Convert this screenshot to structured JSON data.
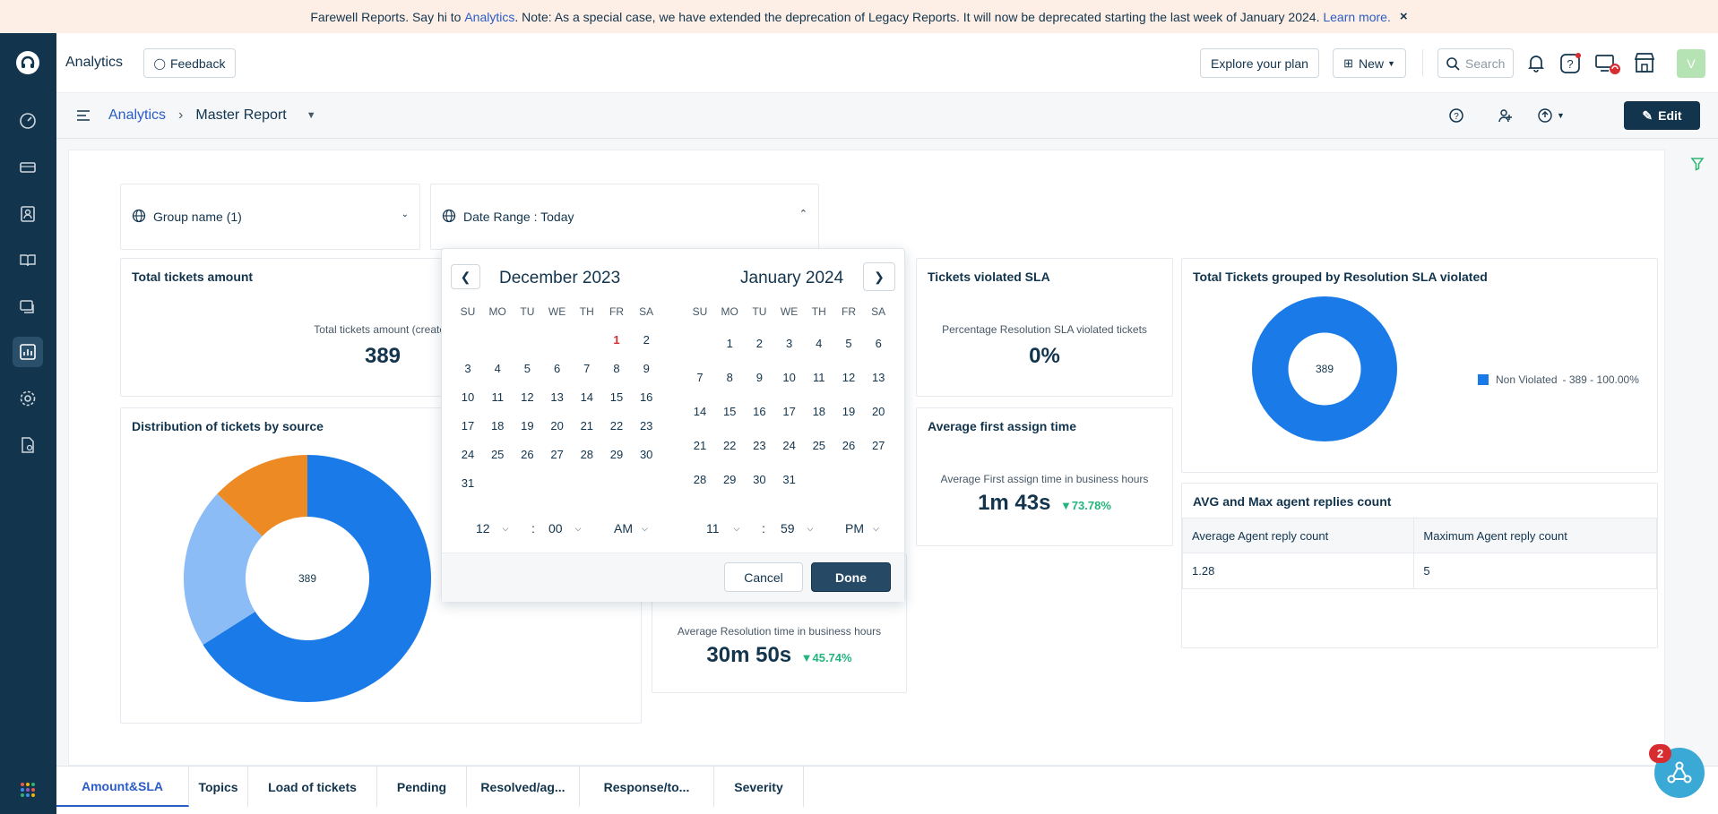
{
  "banner": {
    "text1": "Farewell Reports. Say hi to",
    "link1": "Analytics",
    "text2": ". Note: As a special case, we have extended the deprecation of Legacy Reports. It will now be deprecated starting the last week of January 2024.",
    "link2": "Learn more.",
    "close": "×"
  },
  "topbar": {
    "app_name": "Analytics",
    "feedback": "Feedback",
    "explore": "Explore your plan",
    "new": "New",
    "search_placeholder": "Search",
    "avatar": "V"
  },
  "breadcrumb": {
    "root": "Analytics",
    "sep": "›",
    "current": "Master Report"
  },
  "edit_label": "Edit",
  "filters": {
    "group": "Group name (1)",
    "date": "Date Range :  Today"
  },
  "cards": {
    "total_tickets": {
      "title": "Total tickets amount",
      "sub": "Total tickets amount (created",
      "value": "389"
    },
    "distribution": {
      "title": "Distribution of tickets by source",
      "center": "389"
    },
    "sla_violated": {
      "title": "Tickets violated SLA",
      "sub": "Percentage Resolution SLA violated tickets",
      "value": "0%"
    },
    "first_assign": {
      "title": "Average first assign time",
      "sub": "Average First assign time in business hours",
      "value": "1m 43s",
      "delta": "73.78%"
    },
    "resolution": {
      "sub": "Average Resolution time in business hours",
      "value": "30m 50s",
      "delta": "45.74%"
    },
    "grouped_sla": {
      "title": "Total Tickets grouped by Resolution SLA violated",
      "center": "389",
      "legend": "Non Violated",
      "legend_detail": " - 389 - 100.00%"
    },
    "replies": {
      "title": "AVG and Max agent replies count",
      "headers": [
        "Average Agent reply count",
        "Maximum Agent reply count"
      ],
      "row": [
        "1.28",
        "5"
      ]
    }
  },
  "picker": {
    "left_month": "December 2023",
    "right_month": "January 2024",
    "weekdays": [
      "SU",
      "MO",
      "TU",
      "WE",
      "TH",
      "FR",
      "SA"
    ],
    "dec_weeks": [
      [
        "",
        "",
        "",
        "",
        "",
        "1",
        "2"
      ],
      [
        "3",
        "4",
        "5",
        "6",
        "7",
        "8",
        "9"
      ],
      [
        "10",
        "11",
        "12",
        "13",
        "14",
        "15",
        "16"
      ],
      [
        "17",
        "18",
        "19",
        "20",
        "21",
        "22",
        "23"
      ],
      [
        "24",
        "25",
        "26",
        "27",
        "28",
        "29",
        "30"
      ],
      [
        "31",
        "",
        "",
        "",
        "",
        "",
        ""
      ]
    ],
    "jan_weeks": [
      [
        "",
        "1",
        "2",
        "3",
        "4",
        "5",
        "6"
      ],
      [
        "7",
        "8",
        "9",
        "10",
        "11",
        "12",
        "13"
      ],
      [
        "14",
        "15",
        "16",
        "17",
        "18",
        "19",
        "20"
      ],
      [
        "21",
        "22",
        "23",
        "24",
        "25",
        "26",
        "27"
      ],
      [
        "28",
        "29",
        "30",
        "31",
        "",
        "",
        ""
      ]
    ],
    "start_time": {
      "hour": "12",
      "minute": "00",
      "ampm": "AM"
    },
    "end_time": {
      "hour": "11",
      "minute": "59",
      "ampm": "PM"
    },
    "colon": ":",
    "cancel": "Cancel",
    "done": "Done"
  },
  "tabs": [
    "Amount&SLA",
    "Topics",
    "Load of tickets",
    "Pending",
    "Resolved/ag...",
    "Response/to...",
    "Severity"
  ],
  "notification_count": "2",
  "colors": {
    "nav_bg": "#12344d",
    "link": "#2c5cc5",
    "donut_dark": "#1a7ae8",
    "donut_light": "#8bbcf6",
    "donut_orange": "#ed8a23",
    "positive": "#24b47e",
    "danger": "#d72d30"
  },
  "chart_data": [
    {
      "type": "pie",
      "title": "Distribution of tickets by source",
      "center_label": "389",
      "values": [
        0.66,
        0.21,
        0.13
      ]
    },
    {
      "type": "pie",
      "title": "Total Tickets grouped by Resolution SLA violated",
      "center_label": "389",
      "categories": [
        "Non Violated"
      ],
      "values": [
        389
      ]
    }
  ]
}
